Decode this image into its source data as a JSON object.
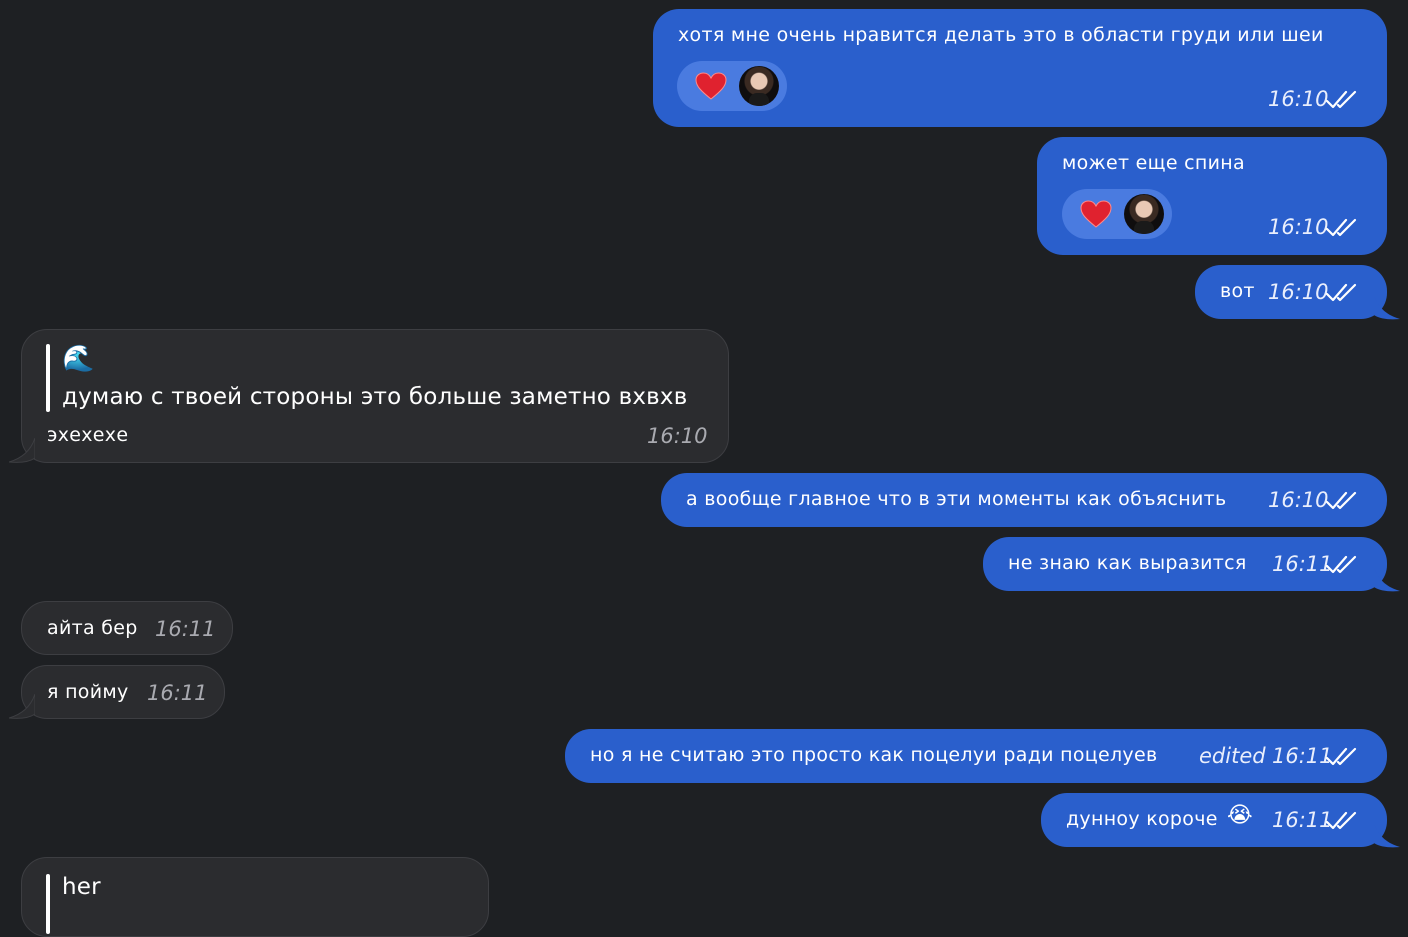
{
  "messages": {
    "m1": {
      "text": "хотя мне очень нравится делать это в области груди или шеи",
      "time": "16:10"
    },
    "m2": {
      "text": "может еще спина",
      "time": "16:10"
    },
    "m3": {
      "text": "вот",
      "time": "16:10"
    },
    "m4": {
      "emoji": "🌊",
      "quote": "думаю с твоей стороны это больше заметно вхвхв",
      "text": "эхехехе",
      "time": "16:10"
    },
    "m5": {
      "text": "а вообще главное что в эти моменты как объяснить",
      "time": "16:10"
    },
    "m6": {
      "text": "не знаю как выразится",
      "time": "16:11"
    },
    "m7": {
      "text": "айта бер",
      "time": "16:11"
    },
    "m8": {
      "text": "я пойму",
      "time": "16:11"
    },
    "m9": {
      "text": "но я не считаю это просто как поцелуи ради поцелуев",
      "edited": "edited",
      "time": "16:11"
    },
    "m10": {
      "text": "дунноу короче",
      "emoji": "😭",
      "time": "16:11"
    },
    "m11": {
      "quote": "her"
    }
  },
  "icons": {
    "reaction": "heart-icon",
    "status": "double-check-icon",
    "avatar": "reactor-avatar"
  },
  "colors": {
    "background": "#1e2023",
    "outgoing": "#2a5fcc",
    "incoming": "#2b2c2f",
    "reaction_pill": "#4a7be0"
  }
}
